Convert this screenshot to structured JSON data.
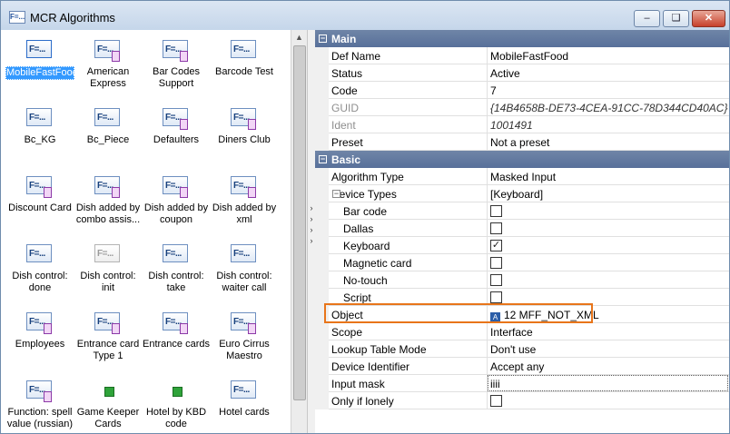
{
  "window": {
    "title": "MCR Algorithms",
    "app_icon": "F=...",
    "controls": [
      "minimize-icon",
      "restore-icon",
      "close-icon"
    ]
  },
  "icon_text": "F=...",
  "algorithms": [
    {
      "label": "MobileFastFood",
      "selected": true
    },
    {
      "label": "American Express",
      "badge": "purple"
    },
    {
      "label": "Bar Codes Support",
      "badge": "purple"
    },
    {
      "label": "Barcode Test"
    },
    {
      "label": "Bc_KG"
    },
    {
      "label": "Bc_Piece"
    },
    {
      "label": "Defaulters",
      "badge": "purple"
    },
    {
      "label": "Diners Club",
      "badge": "purple"
    },
    {
      "label": "Discount Card",
      "badge": "purple"
    },
    {
      "label": "Dish added by combo assis...",
      "badge": "purple"
    },
    {
      "label": "Dish added by coupon",
      "badge": "purple"
    },
    {
      "label": "Dish added by xml",
      "badge": "purple"
    },
    {
      "label": "Dish control: done"
    },
    {
      "label": "Dish control: init",
      "grey": true
    },
    {
      "label": "Dish control: take"
    },
    {
      "label": "Dish control: waiter call"
    },
    {
      "label": "Employees",
      "badge": "purple"
    },
    {
      "label": "Entrance card Type 1",
      "badge": "purple"
    },
    {
      "label": "Entrance cards",
      "badge": "purple"
    },
    {
      "label": "Euro Cirrus Maestro",
      "badge": "purple"
    },
    {
      "label": "Function: spell value (russian)",
      "badge": "purple"
    },
    {
      "label": "Game Keeper Cards",
      "badge": "green"
    },
    {
      "label": "Hotel by KBD code",
      "badge": "green"
    },
    {
      "label": "Hotel cards"
    }
  ],
  "properties": {
    "main": {
      "title": "Main",
      "rows": [
        {
          "name": "Def Name",
          "value": "MobileFastFood"
        },
        {
          "name": "Status",
          "value": "Active"
        },
        {
          "name": "Code",
          "value": "7"
        },
        {
          "name": "GUID",
          "value": "{14B4658B-DE73-4CEA-91CC-78D344CD40AC}",
          "disabled": true,
          "italic": true
        },
        {
          "name": "Ident",
          "value": "1001491",
          "disabled": true,
          "italic": true
        },
        {
          "name": "Preset",
          "value": "Not a preset"
        }
      ]
    },
    "basic": {
      "title": "Basic",
      "algorithm_type": {
        "name": "Algorithm Type",
        "value": "Masked Input"
      },
      "device_types": {
        "name": "Device Types",
        "value": "[Keyboard]"
      },
      "devices": [
        {
          "name": "Bar code",
          "checked": false
        },
        {
          "name": "Dallas",
          "checked": false
        },
        {
          "name": "Keyboard",
          "checked": true
        },
        {
          "name": "Magnetic card",
          "checked": false
        },
        {
          "name": "No-touch",
          "checked": false
        },
        {
          "name": "Script",
          "checked": false
        }
      ],
      "object": {
        "name": "Object",
        "value": "12 MFF_NOT_XML",
        "icon": "A"
      },
      "rest": [
        {
          "name": "Scope",
          "value": "Interface"
        },
        {
          "name": "Lookup Table Mode",
          "value": "Don't use"
        },
        {
          "name": "Device Identifier",
          "value": "Accept any"
        },
        {
          "name": "Input mask",
          "value": "iiii",
          "editing": true
        }
      ],
      "only_if_lonely": {
        "name": "Only if lonely",
        "checked": false
      }
    }
  },
  "colors": {
    "category_bg": "#6f85a7",
    "highlight": "#e8751a",
    "selection": "#3399ff"
  }
}
